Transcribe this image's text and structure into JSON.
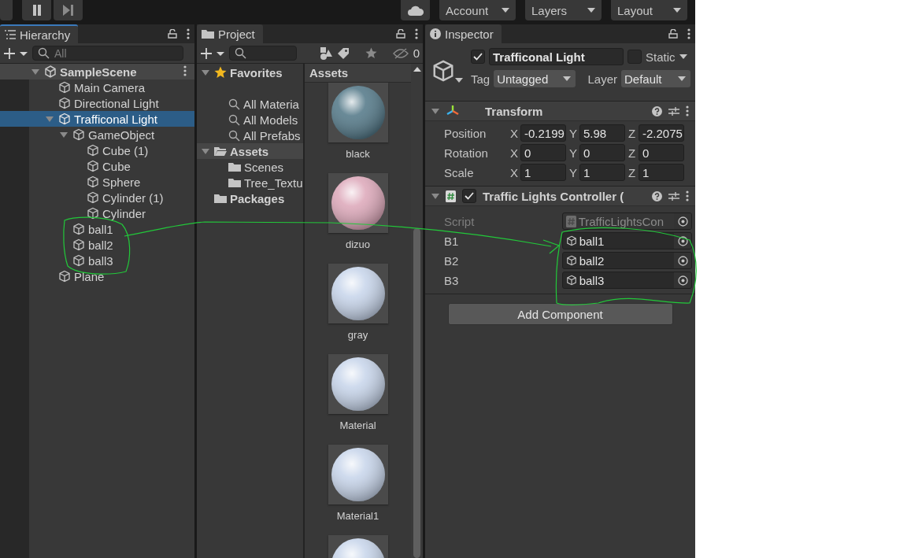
{
  "toolbar": {
    "account": "Account",
    "layers": "Layers",
    "layout": "Layout"
  },
  "hierarchy": {
    "tab": "Hierarchy",
    "search": {
      "placeholder": "All"
    },
    "items": [
      {
        "label": "SampleScene",
        "kind": "scene",
        "selected": false,
        "expanded": true,
        "children": [
          {
            "label": "Main Camera",
            "kind": "object",
            "selected": false
          },
          {
            "label": "Directional Light",
            "kind": "object",
            "selected": false
          },
          {
            "label": "Trafficonal Light",
            "kind": "object",
            "selected": true,
            "expanded": true,
            "children": [
              {
                "label": "GameObject",
                "kind": "object",
                "selected": false,
                "expanded": true,
                "children": [
                  {
                    "label": "Cube (1)",
                    "kind": "object",
                    "selected": false
                  },
                  {
                    "label": "Cube",
                    "kind": "object",
                    "selected": false
                  },
                  {
                    "label": "Sphere",
                    "kind": "object",
                    "selected": false
                  },
                  {
                    "label": "Cylinder (1)",
                    "kind": "object",
                    "selected": false
                  },
                  {
                    "label": "Cylinder",
                    "kind": "object",
                    "selected": false
                  }
                ]
              },
              {
                "label": "ball1",
                "kind": "object",
                "selected": false
              },
              {
                "label": "ball2",
                "kind": "object",
                "selected": false
              },
              {
                "label": "ball3",
                "kind": "object",
                "selected": false
              }
            ]
          },
          {
            "label": "Plane",
            "kind": "object",
            "selected": false
          }
        ]
      }
    ]
  },
  "project": {
    "tab": "Project",
    "hidden_count": "0",
    "sidebar": [
      {
        "label": "Favorites",
        "kind": "favorites",
        "selected": false,
        "expanded": true,
        "children": [
          {
            "label": "All Materia",
            "kind": "search",
            "selected": false
          },
          {
            "label": "All Models",
            "kind": "search",
            "selected": false
          },
          {
            "label": "All Prefabs",
            "kind": "search",
            "selected": false
          }
        ]
      },
      {
        "label": "Assets",
        "kind": "folder",
        "selected": true,
        "expanded": true,
        "children": [
          {
            "label": "Scenes",
            "kind": "folder",
            "selected": false
          },
          {
            "label": "Tree_Textu",
            "kind": "folder",
            "selected": false
          }
        ]
      },
      {
        "label": "Packages",
        "kind": "folder",
        "selected": false
      }
    ],
    "assets_header": "Assets",
    "assets": [
      {
        "label": "black",
        "color": "#4f7585"
      },
      {
        "label": "dizuo",
        "color": "#dca6b8"
      },
      {
        "label": "gray",
        "color": "#c6d4ea"
      },
      {
        "label": "Material",
        "color": "#c6d4ea"
      },
      {
        "label": "Material1",
        "color": "#c6d4ea"
      },
      {
        "color": "#c6d4ea"
      }
    ]
  },
  "inspector": {
    "tab": "Inspector",
    "object": {
      "active": true,
      "name": "Trafficonal Light",
      "static": false,
      "static_label": "Static",
      "tag_label": "Tag",
      "tag": "Untagged",
      "layer_label": "Layer",
      "layer": "Default"
    },
    "components": [
      {
        "kind": "transform",
        "title": "Transform",
        "expanded": true,
        "rows": [
          {
            "label": "Position",
            "values": [
              {
                "axis": "X",
                "value": "-0.2199"
              },
              {
                "axis": "Y",
                "value": "5.98"
              },
              {
                "axis": "Z",
                "value": "-2.2075"
              }
            ]
          },
          {
            "label": "Rotation",
            "values": [
              {
                "axis": "X",
                "value": "0"
              },
              {
                "axis": "Y",
                "value": "0"
              },
              {
                "axis": "Z",
                "value": "0"
              }
            ]
          },
          {
            "label": "Scale",
            "values": [
              {
                "axis": "X",
                "value": "1"
              },
              {
                "axis": "Y",
                "value": "1"
              },
              {
                "axis": "Z",
                "value": "1"
              }
            ]
          }
        ]
      },
      {
        "kind": "script",
        "title": "Traffic Lights Controller (",
        "expanded": true,
        "enabled": true,
        "fields": [
          {
            "label": "Script",
            "kind": "script",
            "value": "TrafficLightsCon",
            "disabled": true
          },
          {
            "label": "B1",
            "kind": "object",
            "value": "ball1",
            "disabled": false
          },
          {
            "label": "B2",
            "kind": "object",
            "value": "ball2",
            "disabled": false
          },
          {
            "label": "B3",
            "kind": "object",
            "value": "ball3",
            "disabled": false
          }
        ]
      }
    ],
    "add_component": "Add Component"
  }
}
